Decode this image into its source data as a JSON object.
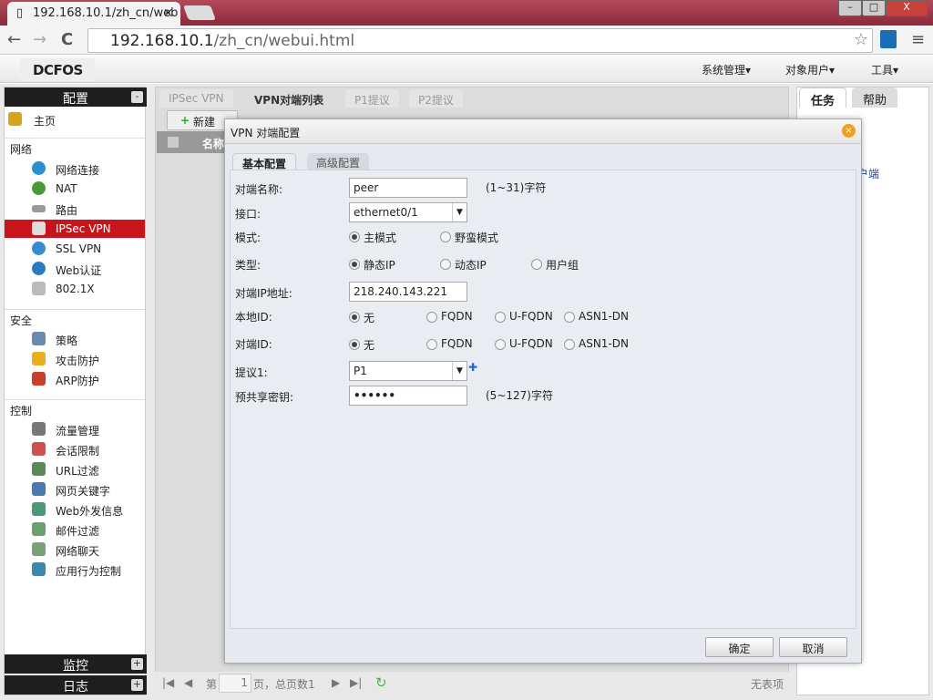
{
  "browser": {
    "tab_title": "192.168.10.1/zh_cn/web",
    "tab_close": "×",
    "url_host": "192.168.10.1",
    "url_path": "/zh_cn/webui.html",
    "back": "←",
    "forward": "→",
    "reload": "C",
    "star": "☆",
    "menu": "≡",
    "min": "–",
    "max": "□",
    "close": "X"
  },
  "header": {
    "logo": "DCFOS",
    "menus": [
      "系统管理▾",
      "对象用户▾",
      "工具▾"
    ]
  },
  "sidebar": {
    "title": "配置",
    "collapse": "-",
    "home": "主页",
    "sections": [
      {
        "label": "网络",
        "items": [
          "网络连接",
          "NAT",
          "路由",
          "IPSec VPN",
          "SSL VPN",
          "Web认证",
          "802.1X"
        ]
      },
      {
        "label": "安全",
        "items": [
          "策略",
          "攻击防护",
          "ARP防护"
        ]
      },
      {
        "label": "控制",
        "items": [
          "流量管理",
          "会话限制",
          "URL过滤",
          "网页关键字",
          "Web外发信息",
          "邮件过滤",
          "网络聊天",
          "应用行为控制"
        ]
      }
    ],
    "active": "IPSec VPN",
    "bottom": [
      {
        "label": "监控",
        "btn": "+"
      },
      {
        "label": "日志",
        "btn": "+"
      }
    ]
  },
  "main": {
    "tabs": [
      "IPSec VPN",
      "VPN对端列表",
      "P1提议",
      "P2提议"
    ],
    "active_tab": "VPN对端列表",
    "new_button": "新建",
    "col_name": "名称",
    "pager": {
      "page_prefix": "第",
      "page": "1",
      "page_suffix": "页，总页数1",
      "empty": "无表项"
    }
  },
  "right": {
    "tabs": [
      "任务",
      "帮助"
    ],
    "fragments": [
      "户端"
    ]
  },
  "modal": {
    "title": "VPN 对端配置",
    "close": "×",
    "tabs": [
      "基本配置",
      "高级配置"
    ],
    "fields": {
      "name_label": "对端名称:",
      "name_value": "peer",
      "name_hint": "(1~31)字符",
      "iface_label": "接口:",
      "iface_value": "ethernet0/1",
      "mode_label": "模式:",
      "mode_options": [
        "主模式",
        "野蛮模式"
      ],
      "type_label": "类型:",
      "type_options": [
        "静态IP",
        "动态IP",
        "用户组"
      ],
      "ip_label": "对端IP地址:",
      "ip_value": "218.240.143.221",
      "localid_label": "本地ID:",
      "id_options": [
        "无",
        "FQDN",
        "U-FQDN",
        "ASN1-DN"
      ],
      "peerid_label": "对端ID:",
      "proposal_label": "提议1:",
      "proposal_value": "P1",
      "add": "✚",
      "psk_label": "预共享密钥:",
      "psk_value": "••••••",
      "psk_hint": "(5~127)字符"
    },
    "ok": "确定",
    "cancel": "取消"
  }
}
